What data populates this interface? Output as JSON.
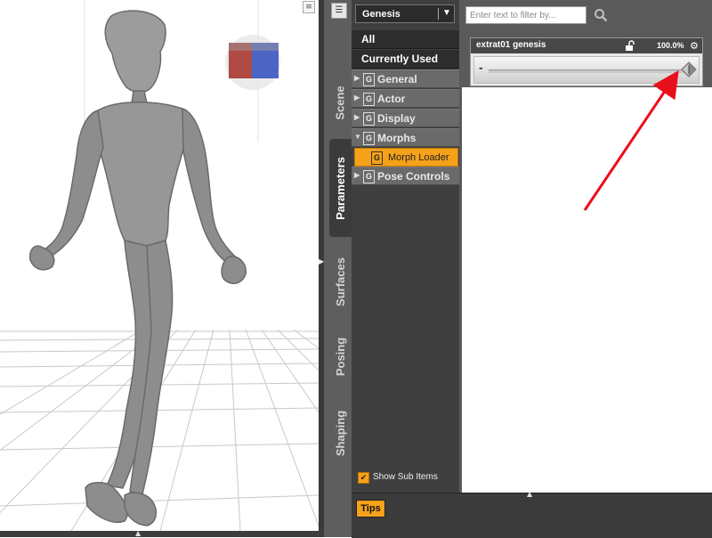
{
  "pane": {
    "tabs": [
      {
        "label": "Scene"
      },
      {
        "label": "Parameters"
      },
      {
        "label": "Surfaces"
      },
      {
        "label": "Posing"
      },
      {
        "label": "Shaping"
      }
    ],
    "active_tab": "Parameters"
  },
  "node_selector": {
    "value": "Genesis"
  },
  "categories": {
    "all": "All",
    "currently_used": "Currently Used",
    "groups": [
      {
        "label": "General",
        "icon": "G"
      },
      {
        "label": "Actor",
        "icon": "G"
      },
      {
        "label": "Display",
        "icon": "G"
      },
      {
        "label": "Morphs",
        "icon": "G"
      },
      {
        "label": "Morph Loader",
        "icon": "G"
      },
      {
        "label": "Pose Controls",
        "icon": "G"
      }
    ],
    "selected": "Morph Loader"
  },
  "show_sub_items": {
    "label": "Show Sub Items",
    "checked": true
  },
  "filter": {
    "placeholder": "Enter text to filter by..."
  },
  "property": {
    "name": "extrat01 genesis",
    "value": "100.0%",
    "minus": "-",
    "slider_fraction": 1.0
  },
  "bottom": {
    "tips_label": "Tips"
  },
  "colors": {
    "accent": "#f5a21a",
    "annotation": "#e8101a",
    "panel_dark": "#3f3f3f"
  }
}
